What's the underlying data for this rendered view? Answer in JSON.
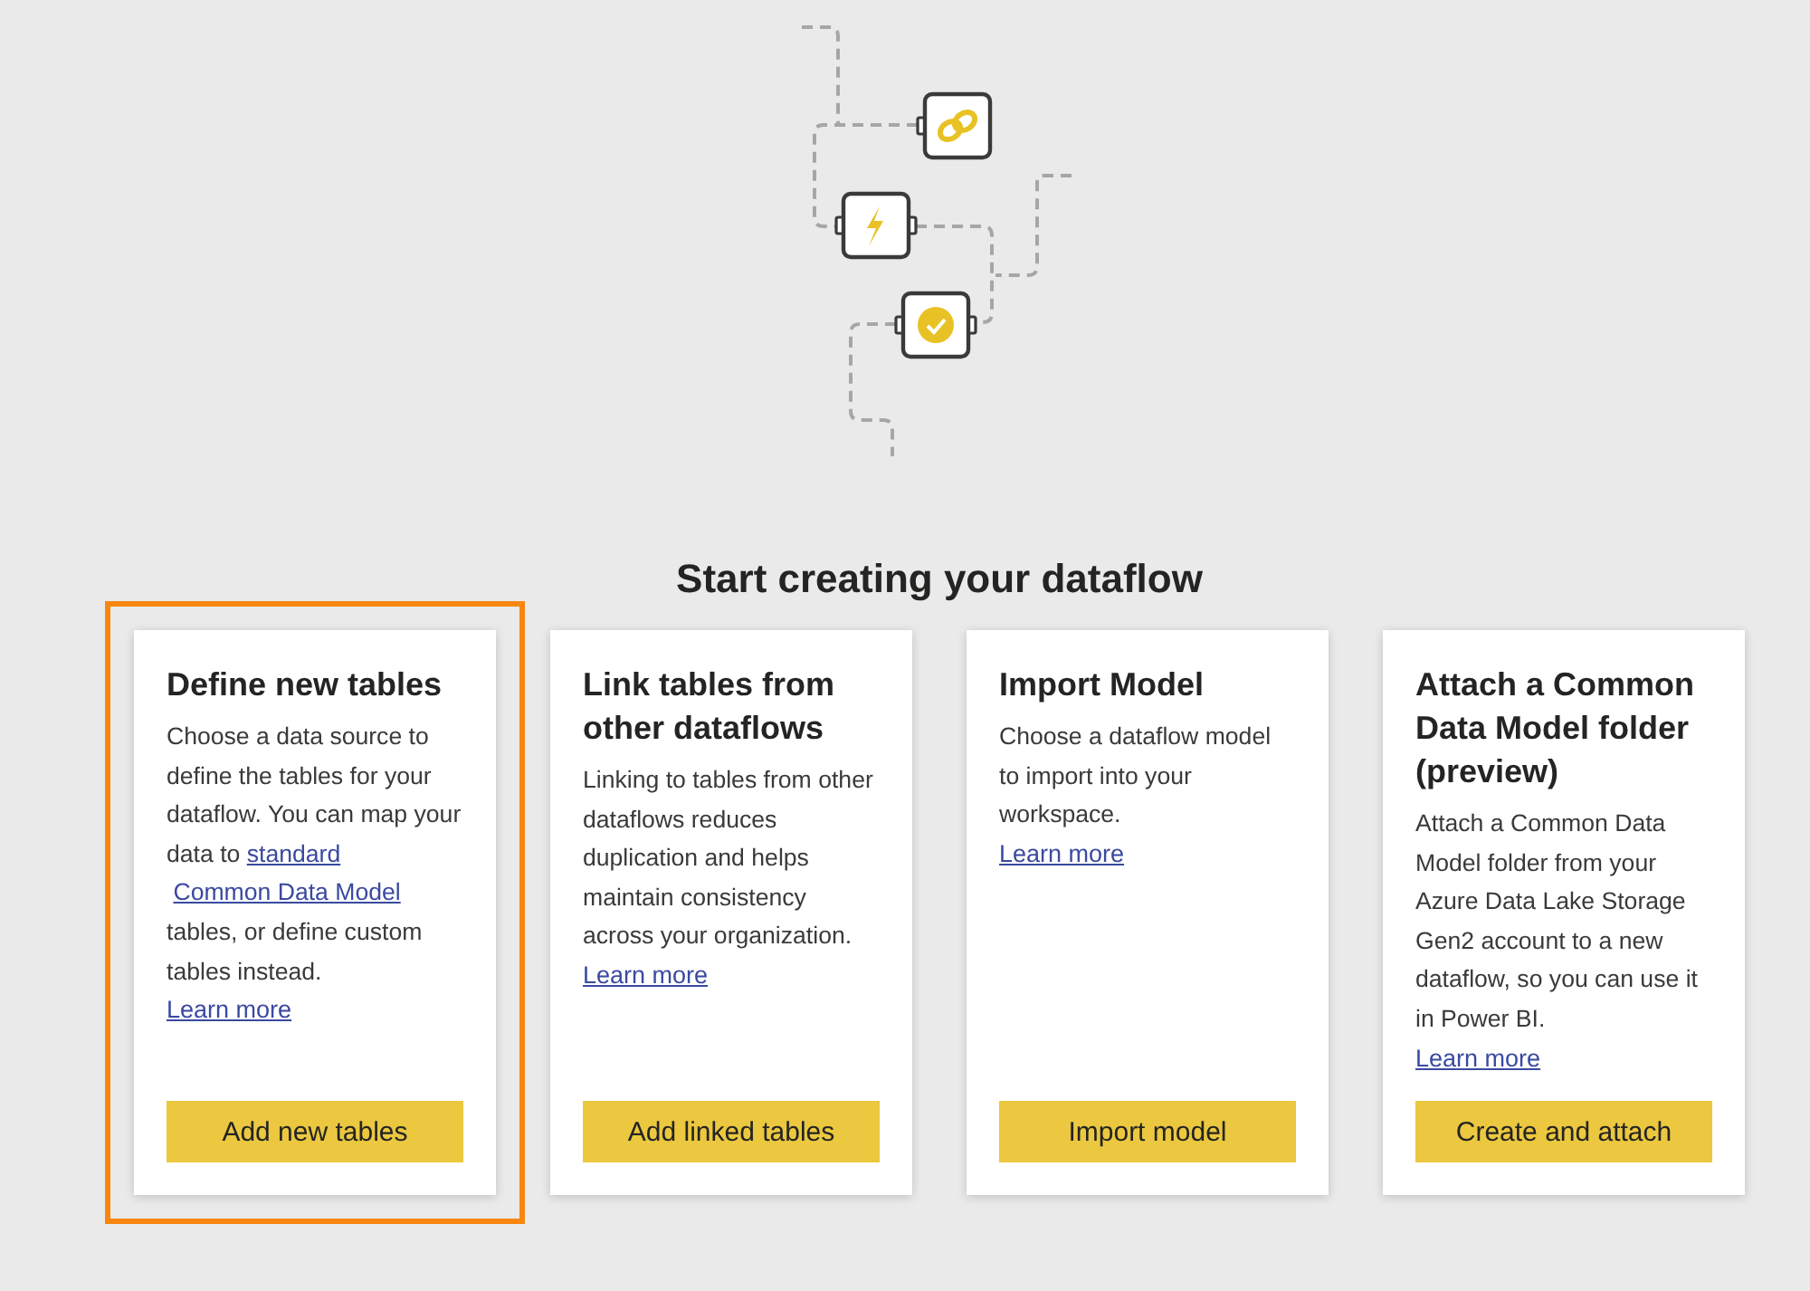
{
  "heading": "Start creating your dataflow",
  "cards": [
    {
      "title": "Define new tables",
      "highlighted": true,
      "description": [
        {
          "kind": "text",
          "text": "Choose a data source to define the tables for your dataflow. You can map your data to "
        },
        {
          "kind": "link",
          "text": "standard"
        },
        {
          "kind": "link",
          "text": "Common Data Model"
        },
        {
          "kind": "text",
          "text": " tables, or define custom tables instead."
        }
      ],
      "link": "Learn more",
      "button": "Add new tables"
    },
    {
      "title": "Link tables from other dataflows",
      "highlighted": false,
      "description": [
        {
          "kind": "text",
          "text": "Linking to tables from other dataflows reduces duplication and helps maintain consistency across your organization."
        }
      ],
      "link": "Learn more",
      "button": "Add linked tables"
    },
    {
      "title": "Import Model",
      "highlighted": false,
      "description": [
        {
          "kind": "text",
          "text": "Choose a dataflow model to import into your workspace."
        }
      ],
      "link": "Learn more",
      "button": "Import model"
    },
    {
      "title": "Attach a Common Data Model folder (preview)",
      "highlighted": false,
      "description": [
        {
          "kind": "text",
          "text": "Attach a Common Data Model folder from your Azure Data Lake Storage Gen2 account to a new dataflow, so you can use it in Power BI."
        }
      ],
      "link": "Learn more",
      "button": "Create and attach"
    }
  ]
}
